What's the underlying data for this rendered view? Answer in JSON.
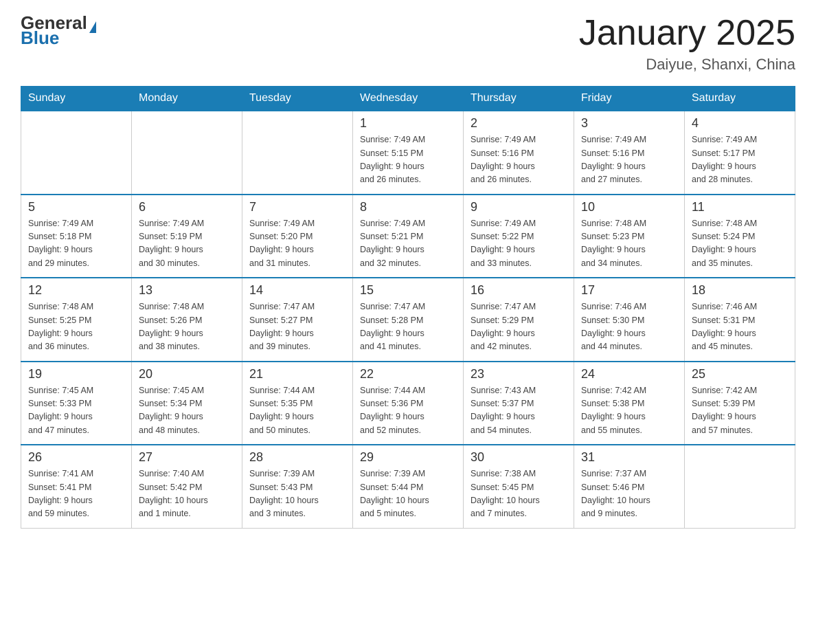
{
  "header": {
    "logo_general": "General",
    "logo_blue": "Blue",
    "title": "January 2025",
    "subtitle": "Daiyue, Shanxi, China"
  },
  "days_of_week": [
    "Sunday",
    "Monday",
    "Tuesday",
    "Wednesday",
    "Thursday",
    "Friday",
    "Saturday"
  ],
  "weeks": [
    [
      {
        "day": "",
        "info": ""
      },
      {
        "day": "",
        "info": ""
      },
      {
        "day": "",
        "info": ""
      },
      {
        "day": "1",
        "info": "Sunrise: 7:49 AM\nSunset: 5:15 PM\nDaylight: 9 hours\nand 26 minutes."
      },
      {
        "day": "2",
        "info": "Sunrise: 7:49 AM\nSunset: 5:16 PM\nDaylight: 9 hours\nand 26 minutes."
      },
      {
        "day": "3",
        "info": "Sunrise: 7:49 AM\nSunset: 5:16 PM\nDaylight: 9 hours\nand 27 minutes."
      },
      {
        "day": "4",
        "info": "Sunrise: 7:49 AM\nSunset: 5:17 PM\nDaylight: 9 hours\nand 28 minutes."
      }
    ],
    [
      {
        "day": "5",
        "info": "Sunrise: 7:49 AM\nSunset: 5:18 PM\nDaylight: 9 hours\nand 29 minutes."
      },
      {
        "day": "6",
        "info": "Sunrise: 7:49 AM\nSunset: 5:19 PM\nDaylight: 9 hours\nand 30 minutes."
      },
      {
        "day": "7",
        "info": "Sunrise: 7:49 AM\nSunset: 5:20 PM\nDaylight: 9 hours\nand 31 minutes."
      },
      {
        "day": "8",
        "info": "Sunrise: 7:49 AM\nSunset: 5:21 PM\nDaylight: 9 hours\nand 32 minutes."
      },
      {
        "day": "9",
        "info": "Sunrise: 7:49 AM\nSunset: 5:22 PM\nDaylight: 9 hours\nand 33 minutes."
      },
      {
        "day": "10",
        "info": "Sunrise: 7:48 AM\nSunset: 5:23 PM\nDaylight: 9 hours\nand 34 minutes."
      },
      {
        "day": "11",
        "info": "Sunrise: 7:48 AM\nSunset: 5:24 PM\nDaylight: 9 hours\nand 35 minutes."
      }
    ],
    [
      {
        "day": "12",
        "info": "Sunrise: 7:48 AM\nSunset: 5:25 PM\nDaylight: 9 hours\nand 36 minutes."
      },
      {
        "day": "13",
        "info": "Sunrise: 7:48 AM\nSunset: 5:26 PM\nDaylight: 9 hours\nand 38 minutes."
      },
      {
        "day": "14",
        "info": "Sunrise: 7:47 AM\nSunset: 5:27 PM\nDaylight: 9 hours\nand 39 minutes."
      },
      {
        "day": "15",
        "info": "Sunrise: 7:47 AM\nSunset: 5:28 PM\nDaylight: 9 hours\nand 41 minutes."
      },
      {
        "day": "16",
        "info": "Sunrise: 7:47 AM\nSunset: 5:29 PM\nDaylight: 9 hours\nand 42 minutes."
      },
      {
        "day": "17",
        "info": "Sunrise: 7:46 AM\nSunset: 5:30 PM\nDaylight: 9 hours\nand 44 minutes."
      },
      {
        "day": "18",
        "info": "Sunrise: 7:46 AM\nSunset: 5:31 PM\nDaylight: 9 hours\nand 45 minutes."
      }
    ],
    [
      {
        "day": "19",
        "info": "Sunrise: 7:45 AM\nSunset: 5:33 PM\nDaylight: 9 hours\nand 47 minutes."
      },
      {
        "day": "20",
        "info": "Sunrise: 7:45 AM\nSunset: 5:34 PM\nDaylight: 9 hours\nand 48 minutes."
      },
      {
        "day": "21",
        "info": "Sunrise: 7:44 AM\nSunset: 5:35 PM\nDaylight: 9 hours\nand 50 minutes."
      },
      {
        "day": "22",
        "info": "Sunrise: 7:44 AM\nSunset: 5:36 PM\nDaylight: 9 hours\nand 52 minutes."
      },
      {
        "day": "23",
        "info": "Sunrise: 7:43 AM\nSunset: 5:37 PM\nDaylight: 9 hours\nand 54 minutes."
      },
      {
        "day": "24",
        "info": "Sunrise: 7:42 AM\nSunset: 5:38 PM\nDaylight: 9 hours\nand 55 minutes."
      },
      {
        "day": "25",
        "info": "Sunrise: 7:42 AM\nSunset: 5:39 PM\nDaylight: 9 hours\nand 57 minutes."
      }
    ],
    [
      {
        "day": "26",
        "info": "Sunrise: 7:41 AM\nSunset: 5:41 PM\nDaylight: 9 hours\nand 59 minutes."
      },
      {
        "day": "27",
        "info": "Sunrise: 7:40 AM\nSunset: 5:42 PM\nDaylight: 10 hours\nand 1 minute."
      },
      {
        "day": "28",
        "info": "Sunrise: 7:39 AM\nSunset: 5:43 PM\nDaylight: 10 hours\nand 3 minutes."
      },
      {
        "day": "29",
        "info": "Sunrise: 7:39 AM\nSunset: 5:44 PM\nDaylight: 10 hours\nand 5 minutes."
      },
      {
        "day": "30",
        "info": "Sunrise: 7:38 AM\nSunset: 5:45 PM\nDaylight: 10 hours\nand 7 minutes."
      },
      {
        "day": "31",
        "info": "Sunrise: 7:37 AM\nSunset: 5:46 PM\nDaylight: 10 hours\nand 9 minutes."
      },
      {
        "day": "",
        "info": ""
      }
    ]
  ]
}
